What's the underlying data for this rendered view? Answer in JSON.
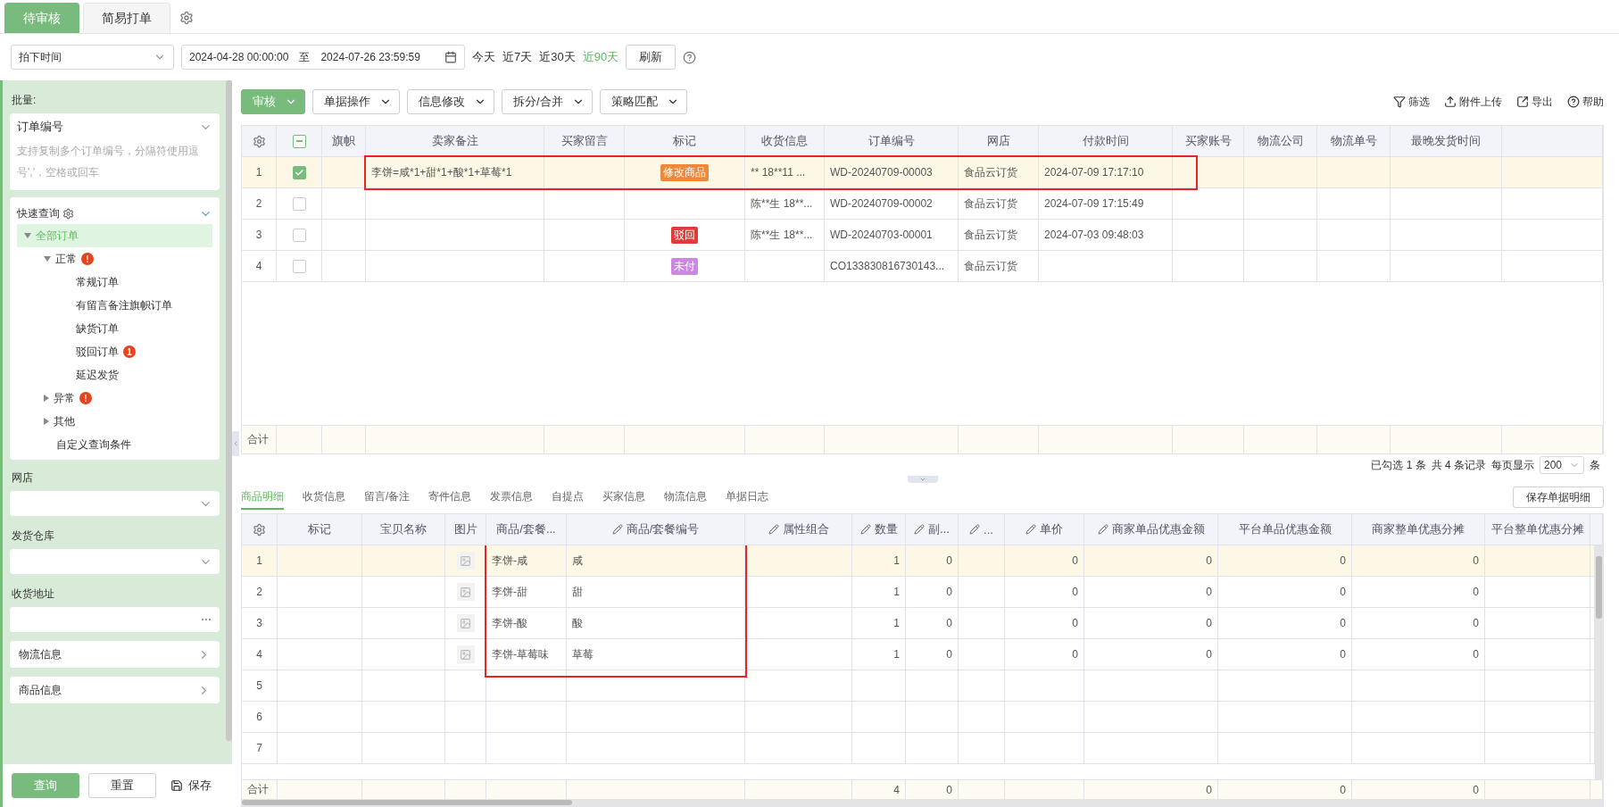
{
  "top_tabs": [
    {
      "label": "待审核",
      "selected": true
    },
    {
      "label": "简易打单",
      "selected": false
    }
  ],
  "filter": {
    "time_field": "拍下时间",
    "start": "2024-04-28 00:00:00",
    "separator": "至",
    "end": "2024-07-26 23:59:59",
    "quick_ranges": [
      {
        "label": "今天",
        "selected": false
      },
      {
        "label": "近7天",
        "selected": false
      },
      {
        "label": "近30天",
        "selected": false
      },
      {
        "label": "近90天",
        "selected": true
      }
    ],
    "refresh": "刷新"
  },
  "sidebar": {
    "batch_label": "批量:",
    "batch_field": "订单编号",
    "batch_placeholder": "支持复制多个订单编号，分隔符使用逗号','，空格或回车",
    "quick_query": {
      "title": "快速查询",
      "expanded": true,
      "tree": [
        {
          "label": "全部订单",
          "expanded": true,
          "selected": true,
          "children": [
            {
              "label": "正常",
              "expanded": true,
              "selected": false,
              "alert": "!",
              "children": [
                {
                  "label": "常规订单",
                  "selected": false
                },
                {
                  "label": "有留言备注旗帜订单",
                  "selected": false
                },
                {
                  "label": "缺货订单",
                  "selected": false
                },
                {
                  "label": "驳回订单",
                  "selected": false,
                  "alert": "1"
                },
                {
                  "label": "延迟发货",
                  "selected": false
                }
              ]
            },
            {
              "label": "异常",
              "expanded": false,
              "selected": false,
              "alert": "!"
            },
            {
              "label": "其他",
              "expanded": false,
              "selected": false
            },
            {
              "label": "自定义查询条件",
              "selected": false
            }
          ]
        }
      ]
    },
    "fields": [
      {
        "label": "网店",
        "kind": "select"
      },
      {
        "label": "发货仓库",
        "kind": "select"
      },
      {
        "label": "收货地址",
        "kind": "more"
      }
    ],
    "panels": [
      {
        "label": "物流信息"
      },
      {
        "label": "商品信息"
      }
    ],
    "buttons": [
      {
        "label": "查询",
        "kind": "primary"
      },
      {
        "label": "重置",
        "kind": "plain"
      },
      {
        "label": "保存",
        "kind": "save"
      }
    ]
  },
  "toolbar": {
    "actions": [
      {
        "label": "审核",
        "kind": "primary"
      },
      {
        "label": "单据操作",
        "kind": "plain"
      },
      {
        "label": "信息修改",
        "kind": "plain"
      },
      {
        "label": "拆分/合并",
        "kind": "plain"
      },
      {
        "label": "策略匹配",
        "kind": "plain"
      }
    ],
    "tools": [
      {
        "label": "筛选",
        "kind": "filter"
      },
      {
        "label": "附件上传",
        "kind": "upload"
      },
      {
        "label": "导出",
        "kind": "export"
      },
      {
        "label": "帮助",
        "kind": "help"
      }
    ]
  },
  "orders": {
    "header_partial": true,
    "highlight_frame": true,
    "columns": [
      {
        "label": "旗帜"
      },
      {
        "label": "卖家备注"
      },
      {
        "label": "买家留言"
      },
      {
        "label": "标记"
      },
      {
        "label": "收货信息"
      },
      {
        "label": "订单编号"
      },
      {
        "label": "网店"
      },
      {
        "label": "付款时间"
      },
      {
        "label": "买家账号"
      },
      {
        "label": "物流公司"
      },
      {
        "label": "物流单号"
      },
      {
        "label": "最晚发货时间"
      }
    ],
    "rows": [
      {
        "no": "1",
        "checked": true,
        "selected": true,
        "seller_note": "李饼=咸*1+甜*1+酸*1+草莓*1",
        "tag": {
          "text": "修改商品",
          "color": "#f0883a"
        },
        "receiver": "** 18**11  ...",
        "order_no": "WD-20240709-00003",
        "shop": "食品云订货",
        "paid_at": "2024-07-09 17:17:10"
      },
      {
        "no": "2",
        "checked": false,
        "selected": false,
        "receiver": "陈**生 18**...",
        "order_no": "WD-20240709-00002",
        "shop": "食品云订货",
        "paid_at": "2024-07-09 17:15:49"
      },
      {
        "no": "3",
        "checked": false,
        "selected": false,
        "tag": {
          "text": "驳回",
          "color": "#e03b3b"
        },
        "receiver": "陈**生 18**...",
        "order_no": "WD-20240703-00001",
        "shop": "食品云订货",
        "paid_at": "2024-07-03 09:48:03"
      },
      {
        "no": "4",
        "checked": false,
        "selected": false,
        "tag": {
          "text": "未付",
          "color": "#cc88e0"
        },
        "order_no": "CO133830816730143...",
        "shop": "食品云订货"
      }
    ],
    "total_label": "合计",
    "pager": {
      "checked_count": "已勾选 1 条",
      "record_count": "共 4 条记录",
      "page_size_label": "每页显示",
      "page_size": "200",
      "unit": "条"
    }
  },
  "detail_tabs": [
    {
      "label": "商品明细",
      "selected": true
    },
    {
      "label": "收货信息",
      "selected": false
    },
    {
      "label": "留言/备注",
      "selected": false
    },
    {
      "label": "寄件信息",
      "selected": false
    },
    {
      "label": "发票信息",
      "selected": false
    },
    {
      "label": "自提点",
      "selected": false
    },
    {
      "label": "买家信息",
      "selected": false
    },
    {
      "label": "物流信息",
      "selected": false
    },
    {
      "label": "单据日志",
      "selected": false
    }
  ],
  "detail_save": "保存单据明细",
  "details": {
    "highlight_frame": true,
    "columns": [
      {
        "label": "标记",
        "kind": "text",
        "editable": false
      },
      {
        "label": "宝贝名称",
        "kind": "text",
        "editable": false
      },
      {
        "label": "图片",
        "kind": "image",
        "editable": false
      },
      {
        "label": "商品/套餐...",
        "kind": "text",
        "editable": false
      },
      {
        "label": "商品/套餐编号",
        "kind": "text",
        "editable": true
      },
      {
        "label": "属性组合",
        "kind": "text",
        "editable": true
      },
      {
        "label": "数量",
        "kind": "number",
        "editable": true
      },
      {
        "label": "副...",
        "kind": "number",
        "editable": true
      },
      {
        "label": "...",
        "kind": "number",
        "editable": true
      },
      {
        "label": "单价",
        "kind": "number",
        "editable": true
      },
      {
        "label": "商家单品优惠金额",
        "kind": "number",
        "editable": true
      },
      {
        "label": "平台单品优惠金额",
        "kind": "number",
        "editable": false
      },
      {
        "label": "商家整单优惠分摊",
        "kind": "number",
        "editable": false
      },
      {
        "label": "平台整单优惠分摊",
        "kind": "number",
        "editable": false
      }
    ],
    "rows": [
      {
        "no": "1",
        "selected": true,
        "image": true,
        "product": "李饼-咸",
        "code": "咸",
        "qty": "1",
        "sub": "0",
        "price": "0",
        "merchant_item_discount": "0",
        "platform_item_discount": "0",
        "merchant_order_share": "0"
      },
      {
        "no": "2",
        "selected": false,
        "image": true,
        "product": "李饼-甜",
        "code": "甜",
        "qty": "1",
        "sub": "0",
        "price": "0",
        "merchant_item_discount": "0",
        "platform_item_discount": "0",
        "merchant_order_share": "0"
      },
      {
        "no": "3",
        "selected": false,
        "image": true,
        "product": "李饼-酸",
        "code": "酸",
        "qty": "1",
        "sub": "0",
        "price": "0",
        "merchant_item_discount": "0",
        "platform_item_discount": "0",
        "merchant_order_share": "0"
      },
      {
        "no": "4",
        "selected": false,
        "image": true,
        "product": "李饼-草莓味",
        "code": "草莓",
        "qty": "1",
        "sub": "0",
        "price": "0",
        "merchant_item_discount": "0",
        "platform_item_discount": "0",
        "merchant_order_share": "0"
      },
      {
        "no": "5",
        "selected": false,
        "image": false
      },
      {
        "no": "6",
        "selected": false,
        "image": false
      },
      {
        "no": "7",
        "selected": false,
        "image": false
      }
    ],
    "total_label": "合计",
    "totals": {
      "qty": "4",
      "sub": "0",
      "merchant_item_discount": "0",
      "platform_item_discount": "0",
      "merchant_order_share": "0"
    }
  }
}
